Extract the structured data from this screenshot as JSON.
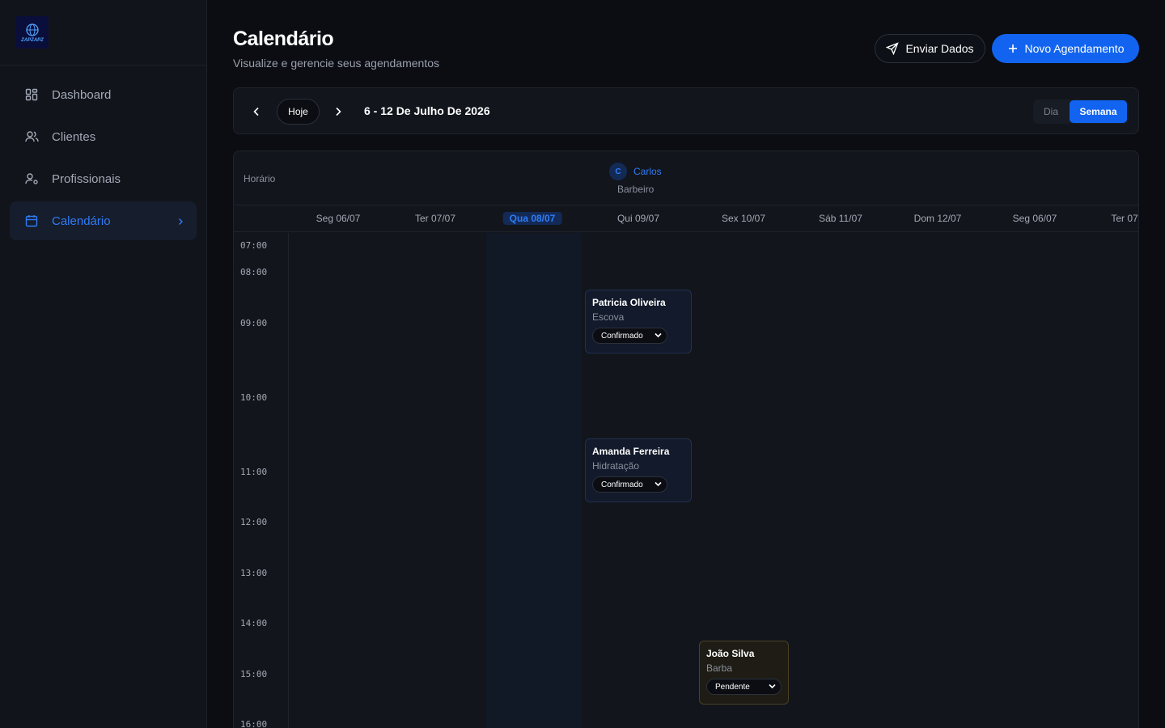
{
  "app": {
    "logo_text": "ZAPZAPZ"
  },
  "sidebar": {
    "items": [
      {
        "label": "Dashboard",
        "icon": "grid-icon"
      },
      {
        "label": "Clientes",
        "icon": "users-icon"
      },
      {
        "label": "Profissionais",
        "icon": "user-cog-icon"
      },
      {
        "label": "Calendário",
        "icon": "calendar-icon",
        "active": true
      }
    ]
  },
  "header": {
    "title": "Calendário",
    "subtitle": "Visualize e gerencie seus agendamentos",
    "send_label": "Enviar Dados",
    "new_label": "Novo Agendamento"
  },
  "toolbar": {
    "today_label": "Hoje",
    "range_label": "6 - 12 De Julho De 2026",
    "view_day": "Dia",
    "view_week": "Semana",
    "active_view": "Semana"
  },
  "calendar": {
    "time_header": "Horário",
    "professional": {
      "initial": "C",
      "name": "Carlos",
      "role": "Barbeiro"
    },
    "days": [
      {
        "label": "Seg 06/07"
      },
      {
        "label": "Ter 07/07"
      },
      {
        "label": "Qua 08/07",
        "today": true
      },
      {
        "label": "Qui 09/07"
      },
      {
        "label": "Sex 10/07"
      },
      {
        "label": "Sáb 11/07"
      },
      {
        "label": "Dom 12/07"
      },
      {
        "label": "Seg 06/07"
      },
      {
        "label": "Ter 07"
      }
    ],
    "times": [
      "07:00",
      "08:00",
      "09:00",
      "10:00",
      "11:00",
      "12:00",
      "13:00",
      "14:00",
      "15:00",
      "16:00"
    ],
    "appointments": [
      {
        "client": "Patricia Oliveira",
        "service": "Escova",
        "status": "Confirmado"
      },
      {
        "client": "Amanda Ferreira",
        "service": "Hidratação",
        "status": "Confirmado"
      },
      {
        "client": "João Silva",
        "service": "Barba",
        "status": "Pendente"
      }
    ]
  },
  "colors": {
    "accent": "#1264f0",
    "background": "#0b0d12",
    "sidebar": "#11141b",
    "pending_border": "#4a4125"
  }
}
